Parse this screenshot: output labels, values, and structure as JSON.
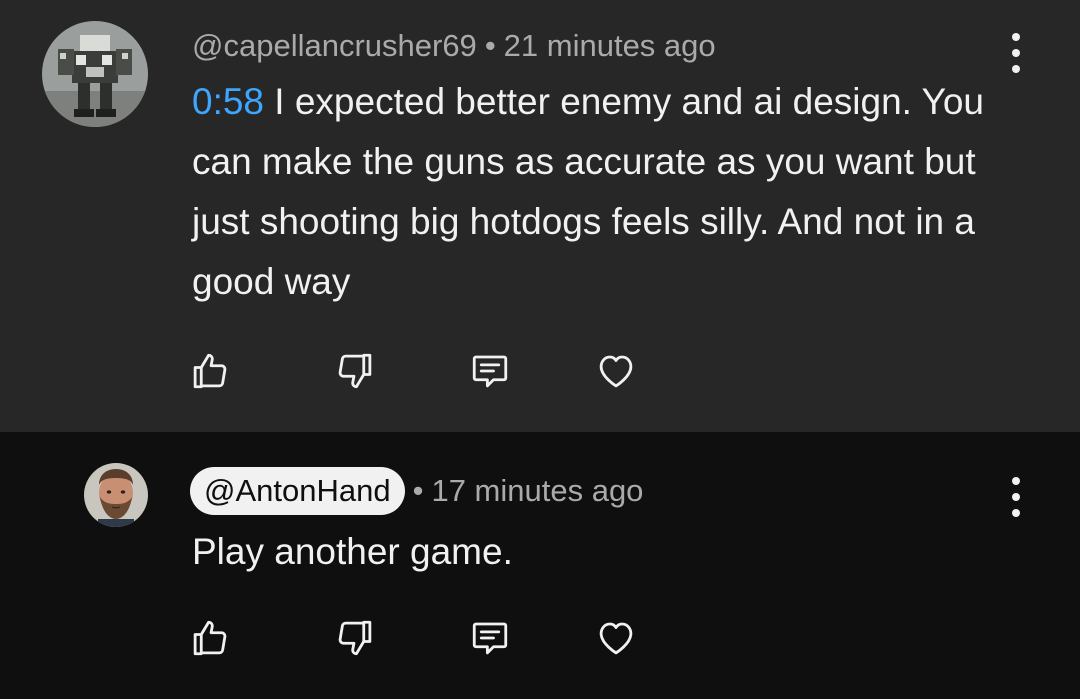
{
  "colors": {
    "top_comment_bg": "#272727",
    "reply_bg": "#0f0f0f",
    "text_primary": "#f1f1f1",
    "text_secondary": "#aaaaaa",
    "timestamp_link": "#3ea6ff",
    "handle_pill_bg": "#f1f1f1"
  },
  "comments": [
    {
      "author": "@capellancrusher69",
      "separator": "•",
      "time": "21 minutes ago",
      "timestamp_link": "0:58",
      "text": " I expected better enemy and ai design. You can make the guns as accurate as you want but just shooting big hotdogs feels silly. And not in a good way",
      "avatar_icon": "mech-robot-avatar",
      "more_icon": "more-vert-icon",
      "actions": [
        {
          "icon": "thumbs-up-icon"
        },
        {
          "icon": "thumbs-down-icon"
        },
        {
          "icon": "reply-icon"
        },
        {
          "icon": "heart-icon"
        }
      ]
    },
    {
      "author": "@AntonHand",
      "separator": "•",
      "time": "17 minutes ago",
      "text": "Play another game.",
      "avatar_icon": "bearded-man-avatar",
      "more_icon": "more-vert-icon",
      "actions": [
        {
          "icon": "thumbs-up-icon"
        },
        {
          "icon": "thumbs-down-icon"
        },
        {
          "icon": "reply-icon"
        },
        {
          "icon": "heart-icon"
        }
      ]
    }
  ]
}
